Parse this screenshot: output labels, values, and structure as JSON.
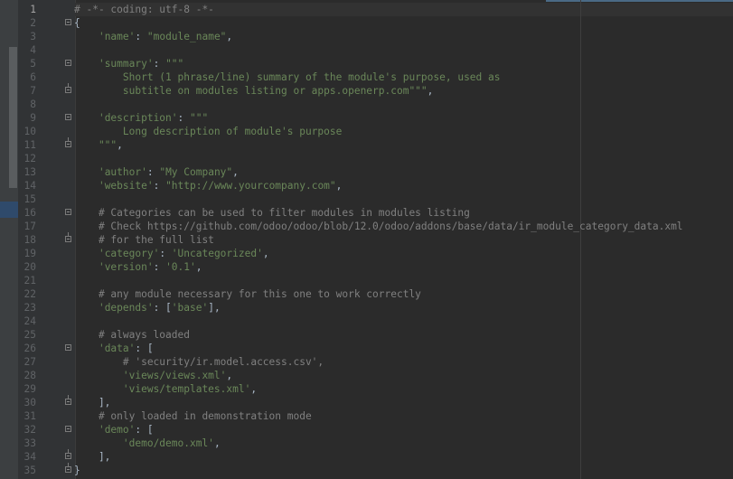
{
  "editor": {
    "lines": [
      {
        "n": "1",
        "fold": "",
        "tokens": [
          {
            "t": "c",
            "v": "# -*- coding: utf-8 -*-"
          }
        ]
      },
      {
        "n": "2",
        "fold": "start",
        "tokens": [
          {
            "t": "p",
            "v": "{"
          }
        ]
      },
      {
        "n": "3",
        "fold": "",
        "tokens": [
          {
            "t": "p",
            "v": "    "
          },
          {
            "t": "s",
            "v": "'name'"
          },
          {
            "t": "p",
            "v": ": "
          },
          {
            "t": "s",
            "v": "\"module_name\""
          },
          {
            "t": "p",
            "v": ","
          }
        ]
      },
      {
        "n": "4",
        "fold": "",
        "tokens": []
      },
      {
        "n": "5",
        "fold": "start",
        "tokens": [
          {
            "t": "p",
            "v": "    "
          },
          {
            "t": "s",
            "v": "'summary'"
          },
          {
            "t": "p",
            "v": ": "
          },
          {
            "t": "s",
            "v": "\"\"\""
          }
        ]
      },
      {
        "n": "6",
        "fold": "",
        "tokens": [
          {
            "t": "s",
            "v": "        Short (1 phrase/line) summary of the module's purpose, used as"
          }
        ]
      },
      {
        "n": "7",
        "fold": "end",
        "tokens": [
          {
            "t": "s",
            "v": "        subtitle on modules listing or apps.openerp.com\"\"\""
          },
          {
            "t": "p",
            "v": ","
          }
        ]
      },
      {
        "n": "8",
        "fold": "",
        "tokens": []
      },
      {
        "n": "9",
        "fold": "start",
        "tokens": [
          {
            "t": "p",
            "v": "    "
          },
          {
            "t": "s",
            "v": "'description'"
          },
          {
            "t": "p",
            "v": ": "
          },
          {
            "t": "s",
            "v": "\"\"\""
          }
        ]
      },
      {
        "n": "10",
        "fold": "",
        "tokens": [
          {
            "t": "s",
            "v": "        Long description of module's purpose"
          }
        ]
      },
      {
        "n": "11",
        "fold": "end",
        "tokens": [
          {
            "t": "s",
            "v": "    \"\"\""
          },
          {
            "t": "p",
            "v": ","
          }
        ]
      },
      {
        "n": "12",
        "fold": "",
        "tokens": []
      },
      {
        "n": "13",
        "fold": "",
        "tokens": [
          {
            "t": "p",
            "v": "    "
          },
          {
            "t": "s",
            "v": "'author'"
          },
          {
            "t": "p",
            "v": ": "
          },
          {
            "t": "s",
            "v": "\"My Company\""
          },
          {
            "t": "p",
            "v": ","
          }
        ]
      },
      {
        "n": "14",
        "fold": "",
        "tokens": [
          {
            "t": "p",
            "v": "    "
          },
          {
            "t": "s",
            "v": "'website'"
          },
          {
            "t": "p",
            "v": ": "
          },
          {
            "t": "s",
            "v": "\"http://www.yourcompany.com\""
          },
          {
            "t": "p",
            "v": ","
          }
        ]
      },
      {
        "n": "15",
        "fold": "",
        "tokens": []
      },
      {
        "n": "16",
        "fold": "start",
        "tokens": [
          {
            "t": "c",
            "v": "    # Categories can be used to filter modules in modules listing"
          }
        ]
      },
      {
        "n": "17",
        "fold": "",
        "tokens": [
          {
            "t": "c",
            "v": "    # Check https://github.com/odoo/odoo/blob/12.0/odoo/addons/base/data/ir_module_category_data.xml"
          }
        ]
      },
      {
        "n": "18",
        "fold": "end",
        "tokens": [
          {
            "t": "c",
            "v": "    # for the full list"
          }
        ]
      },
      {
        "n": "19",
        "fold": "",
        "tokens": [
          {
            "t": "p",
            "v": "    "
          },
          {
            "t": "s",
            "v": "'category'"
          },
          {
            "t": "p",
            "v": ": "
          },
          {
            "t": "s",
            "v": "'Uncategorized'"
          },
          {
            "t": "p",
            "v": ","
          }
        ]
      },
      {
        "n": "20",
        "fold": "",
        "tokens": [
          {
            "t": "p",
            "v": "    "
          },
          {
            "t": "s",
            "v": "'version'"
          },
          {
            "t": "p",
            "v": ": "
          },
          {
            "t": "s",
            "v": "'0.1'"
          },
          {
            "t": "p",
            "v": ","
          }
        ]
      },
      {
        "n": "21",
        "fold": "",
        "tokens": []
      },
      {
        "n": "22",
        "fold": "",
        "tokens": [
          {
            "t": "c",
            "v": "    # any module necessary for this one to work correctly"
          }
        ]
      },
      {
        "n": "23",
        "fold": "",
        "tokens": [
          {
            "t": "p",
            "v": "    "
          },
          {
            "t": "s",
            "v": "'depends'"
          },
          {
            "t": "p",
            "v": ": ["
          },
          {
            "t": "s",
            "v": "'base'"
          },
          {
            "t": "p",
            "v": "],"
          }
        ]
      },
      {
        "n": "24",
        "fold": "",
        "tokens": []
      },
      {
        "n": "25",
        "fold": "",
        "tokens": [
          {
            "t": "c",
            "v": "    # always loaded"
          }
        ]
      },
      {
        "n": "26",
        "fold": "start",
        "tokens": [
          {
            "t": "p",
            "v": "    "
          },
          {
            "t": "s",
            "v": "'data'"
          },
          {
            "t": "p",
            "v": ": ["
          }
        ]
      },
      {
        "n": "27",
        "fold": "",
        "tokens": [
          {
            "t": "c",
            "v": "        # 'security/ir.model.access.csv',"
          }
        ]
      },
      {
        "n": "28",
        "fold": "",
        "tokens": [
          {
            "t": "p",
            "v": "        "
          },
          {
            "t": "s",
            "v": "'views/views.xml'"
          },
          {
            "t": "p",
            "v": ","
          }
        ]
      },
      {
        "n": "29",
        "fold": "",
        "tokens": [
          {
            "t": "p",
            "v": "        "
          },
          {
            "t": "s",
            "v": "'views/templates.xml'"
          },
          {
            "t": "p",
            "v": ","
          }
        ]
      },
      {
        "n": "30",
        "fold": "end",
        "tokens": [
          {
            "t": "p",
            "v": "    ],"
          }
        ]
      },
      {
        "n": "31",
        "fold": "",
        "tokens": [
          {
            "t": "c",
            "v": "    # only loaded in demonstration mode"
          }
        ]
      },
      {
        "n": "32",
        "fold": "start",
        "tokens": [
          {
            "t": "p",
            "v": "    "
          },
          {
            "t": "s",
            "v": "'demo'"
          },
          {
            "t": "p",
            "v": ": ["
          }
        ]
      },
      {
        "n": "33",
        "fold": "",
        "tokens": [
          {
            "t": "p",
            "v": "        "
          },
          {
            "t": "s",
            "v": "'demo/demo.xml'"
          },
          {
            "t": "p",
            "v": ","
          }
        ]
      },
      {
        "n": "34",
        "fold": "end",
        "tokens": [
          {
            "t": "p",
            "v": "    ],"
          }
        ]
      },
      {
        "n": "35",
        "fold": "end",
        "tokens": [
          {
            "t": "p",
            "v": "}"
          }
        ]
      }
    ],
    "current_line": "1",
    "colors": {
      "background": "#2b2b2b",
      "gutter": "#313335",
      "line_number": "#606366",
      "comment": "#808080",
      "string": "#6a8759",
      "plain": "#a9b7c6"
    }
  }
}
